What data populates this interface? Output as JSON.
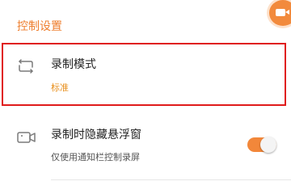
{
  "section": {
    "title": "控制设置"
  },
  "floating_button": {
    "icon": "video-camera-icon",
    "color": "#f28a3c"
  },
  "record_mode": {
    "icon": "rotate-loop-icon",
    "title": "录制模式",
    "value": "标准",
    "value_color": "#e88f1c"
  },
  "hide_float_window": {
    "icon": "video-camera-icon",
    "title": "录制时隐藏悬浮窗",
    "description": "仅使用通知栏控制录屏",
    "toggle_on": true,
    "toggle_color": "#f2873a"
  },
  "highlight_color": "#e01b1b"
}
